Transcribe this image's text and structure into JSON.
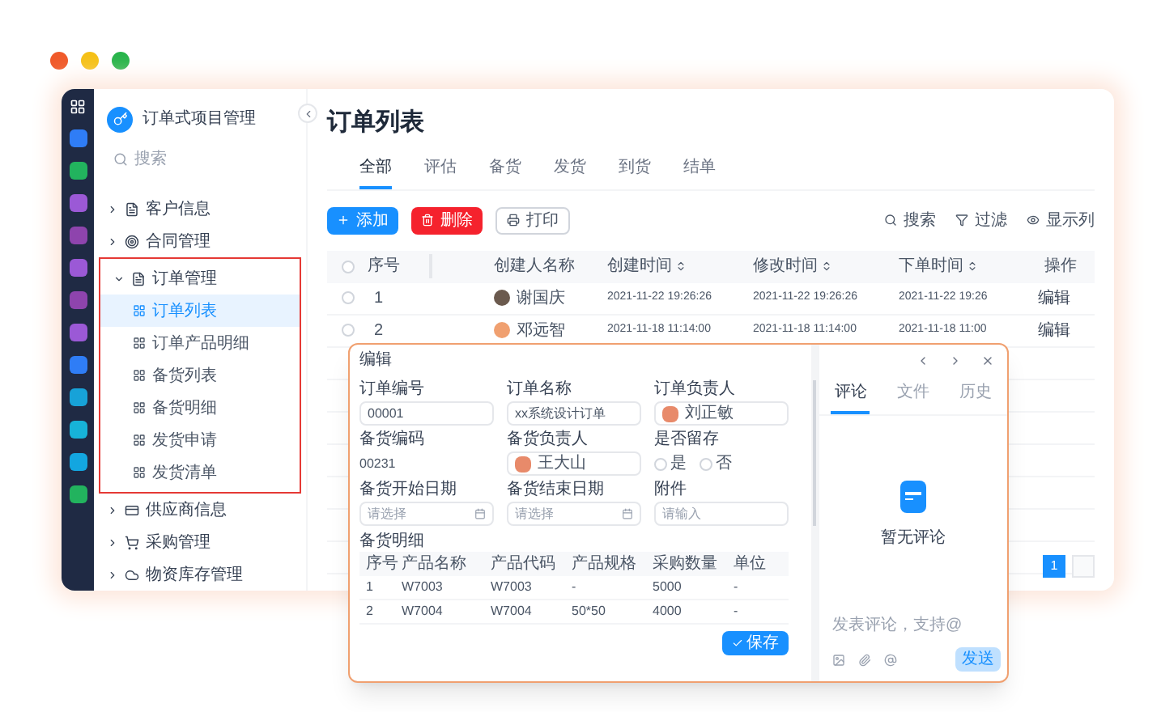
{
  "sidebar": {
    "title": "订单式项目管理",
    "search": {
      "placeholder": "搜索"
    },
    "items": [
      {
        "label": "客户信息",
        "expanded": false,
        "highlighted": false
      },
      {
        "label": "合同管理",
        "expanded": false,
        "highlighted": false
      },
      {
        "label": "订单管理",
        "expanded": true,
        "highlighted": true,
        "children": [
          {
            "label": "订单列表",
            "selected": true
          },
          {
            "label": "订单产品明细",
            "selected": false
          },
          {
            "label": "备货列表",
            "selected": false
          },
          {
            "label": "备货明细",
            "selected": false
          },
          {
            "label": "发货申请",
            "selected": false
          },
          {
            "label": "发货清单",
            "selected": false
          }
        ]
      },
      {
        "label": "供应商信息",
        "expanded": false,
        "highlighted": false
      },
      {
        "label": "采购管理",
        "expanded": false,
        "highlighted": false
      },
      {
        "label": "物资库存管理",
        "expanded": false,
        "highlighted": false
      }
    ]
  },
  "page": {
    "title": "订单列表",
    "tabs": [
      {
        "label": "全部",
        "selected": true
      },
      {
        "label": "评估",
        "selected": false
      },
      {
        "label": "备货",
        "selected": false
      },
      {
        "label": "发货",
        "selected": false
      },
      {
        "label": "到货",
        "selected": false
      },
      {
        "label": "结单",
        "selected": false
      }
    ],
    "actions": [
      {
        "kind": "add",
        "label": "添加"
      },
      {
        "kind": "delete",
        "label": "删除"
      },
      {
        "kind": "print",
        "label": "打印"
      }
    ],
    "tools": [
      {
        "kind": "search",
        "label": "搜索"
      },
      {
        "kind": "filter",
        "label": "过滤"
      },
      {
        "kind": "columns",
        "label": "显示列"
      }
    ],
    "table": {
      "all_checked": false,
      "columns": [
        {
          "label": "序号",
          "sortable": false
        },
        {
          "label": "创建人名称",
          "sortable": false
        },
        {
          "label": "创建时间",
          "sortable": true
        },
        {
          "label": "修改时间",
          "sortable": true
        },
        {
          "label": "下单时间",
          "sortable": true
        },
        {
          "label": "操作",
          "sortable": false
        }
      ],
      "rows": [
        {
          "checked": false,
          "cells": [
            "1",
            "谢国庆",
            "2021-11-22 19:26:26",
            "2021-11-22 19:26:26",
            "2021-11-22 19:26",
            "编辑"
          ]
        },
        {
          "checked": false,
          "cells": [
            "2",
            "邓远智",
            "2021-11-18 11:14:00",
            "2021-11-18 11:14:00",
            "2021-11-18 11:00",
            "编辑"
          ]
        }
      ]
    },
    "pagination": {
      "pages": [
        {
          "label": "1",
          "selected": true
        }
      ]
    }
  },
  "modal": {
    "title": "编辑",
    "fields": [
      {
        "kind": "input",
        "label": "订单编号",
        "value": "00001"
      },
      {
        "kind": "input",
        "label": "订单名称",
        "value": "xx系统设计订单"
      },
      {
        "kind": "person",
        "label": "订单负责人",
        "value": "刘正敏"
      },
      {
        "kind": "text",
        "label": "备货编码",
        "value": "00231"
      },
      {
        "kind": "person",
        "label": "备货负责人",
        "value": "王大山"
      },
      {
        "kind": "radio",
        "label": "是否留存",
        "options": [
          {
            "label": "是",
            "selected": false
          },
          {
            "label": "否",
            "selected": false
          }
        ]
      },
      {
        "kind": "date",
        "label": "备货开始日期",
        "placeholder": "请选择"
      },
      {
        "kind": "date",
        "label": "备货结束日期",
        "placeholder": "请选择"
      },
      {
        "kind": "input",
        "label": "附件",
        "placeholder": "请输入"
      }
    ],
    "detail": {
      "title": "备货明细",
      "columns": [
        "序号",
        "产品名称",
        "产品代码",
        "产品规格",
        "采购数量",
        "单位"
      ],
      "rows": [
        [
          "1",
          "W7003",
          "W7003",
          "-",
          "5000",
          "-"
        ],
        [
          "2",
          "W7004",
          "W7004",
          "50*50",
          "4000",
          "-"
        ]
      ]
    },
    "save": "保存",
    "side_tabs": [
      {
        "label": "评论",
        "selected": true
      },
      {
        "label": "文件",
        "selected": false
      },
      {
        "label": "历史",
        "selected": false
      }
    ],
    "empty": "暂无评论",
    "comment": {
      "placeholder": "发表评论，支持@"
    },
    "send": "发送"
  }
}
